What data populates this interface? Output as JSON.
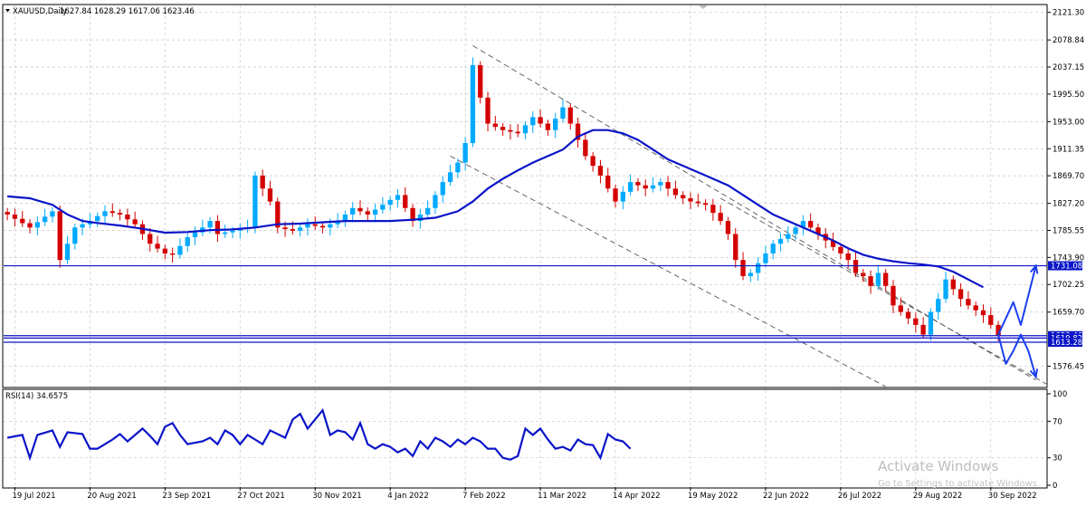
{
  "chart_data": {
    "type": "candlestick",
    "symbol": "XAUUSD,Daily",
    "ohlc": "1627.84 1628.29 1617.06 1623.46",
    "y_axis_ticks": [
      "2121.30",
      "2078.84",
      "2037.15",
      "1995.50",
      "1953.00",
      "1911.35",
      "1869.70",
      "1827.20",
      "1785.55",
      "1743.90",
      "1702.25",
      "1659.70",
      "1576.45"
    ],
    "ylim": [
      1545,
      2132
    ],
    "x_axis_ticks": [
      "19 Jul 2021",
      "20 Aug 2021",
      "23 Sep 2021",
      "27 Oct 2021",
      "30 Nov 2021",
      "4 Jan 2022",
      "7 Feb 2022",
      "11 Mar 2022",
      "14 Apr 2022",
      "19 May 2022",
      "22 Jun 2022",
      "26 Jul 2022",
      "29 Aug 2022",
      "30 Sep 2022"
    ],
    "close_path": [
      [
        0,
        1810
      ],
      [
        3,
        1790
      ],
      [
        6,
        1815
      ],
      [
        7,
        1740
      ],
      [
        9,
        1790
      ],
      [
        11,
        1800
      ],
      [
        13,
        1815
      ],
      [
        15,
        1810
      ],
      [
        17,
        1795
      ],
      [
        19,
        1765
      ],
      [
        21,
        1750
      ],
      [
        22,
        1748
      ],
      [
        24,
        1775
      ],
      [
        26,
        1790
      ],
      [
        27,
        1800
      ],
      [
        28,
        1780
      ],
      [
        30,
        1785
      ],
      [
        32,
        1790
      ],
      [
        33,
        1870
      ],
      [
        35,
        1830
      ],
      [
        36,
        1790
      ],
      [
        38,
        1785
      ],
      [
        40,
        1795
      ],
      [
        42,
        1790
      ],
      [
        44,
        1800
      ],
      [
        46,
        1820
      ],
      [
        48,
        1810
      ],
      [
        50,
        1825
      ],
      [
        52,
        1840
      ],
      [
        54,
        1800
      ],
      [
        56,
        1820
      ],
      [
        58,
        1860
      ],
      [
        60,
        1890
      ],
      [
        61,
        1920
      ],
      [
        62,
        2040
      ],
      [
        63,
        1990
      ],
      [
        64,
        1950
      ],
      [
        66,
        1940
      ],
      [
        68,
        1935
      ],
      [
        70,
        1960
      ],
      [
        72,
        1940
      ],
      [
        74,
        1975
      ],
      [
        75,
        1950
      ],
      [
        77,
        1900
      ],
      [
        79,
        1870
      ],
      [
        80,
        1850
      ],
      [
        81,
        1830
      ],
      [
        83,
        1860
      ],
      [
        85,
        1850
      ],
      [
        87,
        1860
      ],
      [
        89,
        1840
      ],
      [
        91,
        1830
      ],
      [
        93,
        1825
      ],
      [
        95,
        1800
      ],
      [
        96,
        1780
      ],
      [
        97,
        1740
      ],
      [
        98,
        1715
      ],
      [
        99,
        1720
      ],
      [
        101,
        1750
      ],
      [
        102,
        1765
      ],
      [
        104,
        1780
      ],
      [
        106,
        1800
      ],
      [
        107,
        1790
      ],
      [
        108,
        1780
      ],
      [
        110,
        1760
      ],
      [
        112,
        1740
      ],
      [
        113,
        1720
      ],
      [
        114,
        1715
      ],
      [
        115,
        1700
      ],
      [
        116,
        1720
      ],
      [
        117,
        1700
      ],
      [
        118,
        1670
      ],
      [
        120,
        1650
      ],
      [
        121,
        1640
      ],
      [
        122,
        1625
      ],
      [
        123,
        1660
      ],
      [
        124,
        1680
      ],
      [
        125,
        1710
      ],
      [
        127,
        1680
      ],
      [
        128,
        1670
      ],
      [
        130,
        1655
      ],
      [
        131,
        1640
      ],
      [
        132,
        1623.46
      ]
    ],
    "ma_path": [
      [
        0,
        1838
      ],
      [
        3,
        1835
      ],
      [
        6,
        1825
      ],
      [
        8,
        1810
      ],
      [
        10,
        1800
      ],
      [
        12,
        1797
      ],
      [
        15,
        1793
      ],
      [
        18,
        1788
      ],
      [
        21,
        1782
      ],
      [
        24,
        1783
      ],
      [
        27,
        1786
      ],
      [
        30,
        1787
      ],
      [
        33,
        1790
      ],
      [
        36,
        1795
      ],
      [
        39,
        1796
      ],
      [
        42,
        1798
      ],
      [
        45,
        1800
      ],
      [
        48,
        1800
      ],
      [
        51,
        1800
      ],
      [
        54,
        1802
      ],
      [
        57,
        1805
      ],
      [
        60,
        1815
      ],
      [
        62,
        1830
      ],
      [
        64,
        1850
      ],
      [
        66,
        1865
      ],
      [
        68,
        1878
      ],
      [
        70,
        1890
      ],
      [
        72,
        1900
      ],
      [
        74,
        1910
      ],
      [
        76,
        1930
      ],
      [
        78,
        1940
      ],
      [
        80,
        1940
      ],
      [
        82,
        1935
      ],
      [
        84,
        1925
      ],
      [
        86,
        1910
      ],
      [
        88,
        1895
      ],
      [
        90,
        1885
      ],
      [
        92,
        1875
      ],
      [
        94,
        1865
      ],
      [
        96,
        1855
      ],
      [
        98,
        1840
      ],
      [
        100,
        1825
      ],
      [
        102,
        1810
      ],
      [
        104,
        1800
      ],
      [
        106,
        1790
      ],
      [
        108,
        1780
      ],
      [
        110,
        1770
      ],
      [
        112,
        1758
      ],
      [
        114,
        1748
      ],
      [
        116,
        1742
      ],
      [
        118,
        1738
      ],
      [
        120,
        1735
      ],
      [
        122,
        1733
      ],
      [
        124,
        1730
      ],
      [
        126,
        1722
      ],
      [
        128,
        1710
      ],
      [
        130,
        1698
      ]
    ],
    "horizontal_levels": [
      {
        "value": 1731.08,
        "label": "1731.08"
      },
      {
        "value": 1623.46,
        "label": "1623.46"
      },
      {
        "value": 1619.82,
        "label": "1619.82"
      },
      {
        "value": 1613.28,
        "label": "1613.28"
      }
    ],
    "channel_lines": [
      [
        [
          62,
          2070
        ],
        [
          137,
          1555
        ]
      ],
      [
        [
          59,
          1900
        ],
        [
          117,
          1545
        ]
      ],
      [
        [
          95,
          1835
        ],
        [
          139,
          1545
        ]
      ]
    ],
    "scenario_up": [
      [
        132,
        1625
      ],
      [
        134,
        1675
      ],
      [
        135,
        1640
      ],
      [
        137,
        1731
      ]
    ],
    "scenario_down": [
      [
        132,
        1625
      ],
      [
        133,
        1580
      ],
      [
        134,
        1600
      ],
      [
        135,
        1625
      ],
      [
        136,
        1600
      ],
      [
        137,
        1560
      ]
    ],
    "rsi": {
      "label": "RSI(14) 34.6575",
      "ylim": [
        0,
        100
      ],
      "ticks": [
        "100",
        "70",
        "30",
        "0"
      ],
      "path": [
        [
          0,
          52
        ],
        [
          2,
          55
        ],
        [
          3,
          30
        ],
        [
          4,
          55
        ],
        [
          6,
          60
        ],
        [
          7,
          42
        ],
        [
          8,
          58
        ],
        [
          10,
          56
        ],
        [
          11,
          40
        ],
        [
          12,
          40
        ],
        [
          13,
          45
        ],
        [
          14,
          50
        ],
        [
          15,
          56
        ],
        [
          16,
          48
        ],
        [
          18,
          62
        ],
        [
          19,
          54
        ],
        [
          20,
          45
        ],
        [
          21,
          64
        ],
        [
          22,
          68
        ],
        [
          23,
          55
        ],
        [
          24,
          45
        ],
        [
          26,
          48
        ],
        [
          27,
          52
        ],
        [
          28,
          45
        ],
        [
          29,
          60
        ],
        [
          30,
          55
        ],
        [
          31,
          45
        ],
        [
          32,
          55
        ],
        [
          33,
          50
        ],
        [
          34,
          45
        ],
        [
          35,
          60
        ],
        [
          37,
          52
        ],
        [
          38,
          72
        ],
        [
          39,
          78
        ],
        [
          40,
          62
        ],
        [
          41,
          72
        ],
        [
          42,
          82
        ],
        [
          43,
          55
        ],
        [
          44,
          60
        ],
        [
          45,
          58
        ],
        [
          46,
          50
        ],
        [
          47,
          68
        ],
        [
          48,
          45
        ],
        [
          49,
          40
        ],
        [
          50,
          45
        ],
        [
          51,
          42
        ],
        [
          52,
          36
        ],
        [
          53,
          40
        ],
        [
          54,
          32
        ],
        [
          55,
          48
        ],
        [
          56,
          40
        ],
        [
          57,
          52
        ],
        [
          58,
          48
        ],
        [
          59,
          42
        ],
        [
          60,
          50
        ],
        [
          61,
          45
        ],
        [
          62,
          52
        ],
        [
          63,
          48
        ],
        [
          64,
          40
        ],
        [
          65,
          40
        ],
        [
          66,
          30
        ],
        [
          67,
          28
        ],
        [
          68,
          32
        ],
        [
          69,
          62
        ],
        [
          70,
          55
        ],
        [
          71,
          62
        ],
        [
          72,
          50
        ],
        [
          73,
          40
        ],
        [
          74,
          42
        ],
        [
          75,
          38
        ],
        [
          76,
          50
        ],
        [
          77,
          45
        ],
        [
          78,
          44
        ],
        [
          79,
          30
        ],
        [
          80,
          56
        ],
        [
          81,
          50
        ],
        [
          82,
          48
        ],
        [
          83,
          40
        ]
      ]
    }
  },
  "watermark": {
    "title": "Activate Windows",
    "subtitle": "Go to Settings to activate Windows."
  },
  "colors": {
    "candle": "#00aaff",
    "candle_down": "#d40000",
    "ma": "#0a14c8",
    "level": "#0a14c8",
    "scenario": "#1a3ff0",
    "channel": "#555555",
    "grid": "#c8c8c8"
  }
}
